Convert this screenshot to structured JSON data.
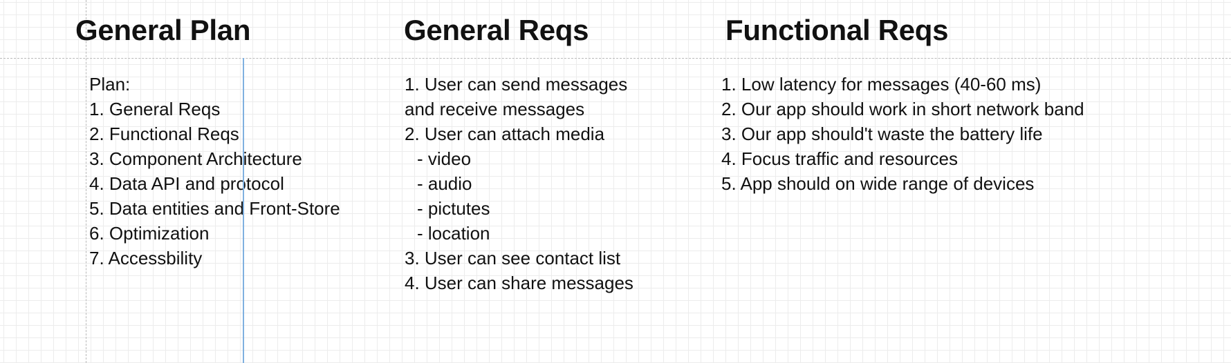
{
  "columns": [
    {
      "heading": "General Plan",
      "lines": [
        "Plan:",
        "1. General Reqs",
        "2. Functional Reqs",
        "3. Component Architecture",
        "4. Data API and protocol",
        "5. Data entities and Front-Store",
        "6. Optimization",
        "7. Accessbility"
      ]
    },
    {
      "heading": "General Reqs",
      "lines": [
        "1. User can send messages",
        "and receive messages",
        "2. User can attach media",
        "- video",
        "- audio",
        "- pictutes",
        "- location",
        "3. User can see contact list",
        "4. User can share messages"
      ]
    },
    {
      "heading": "Functional Reqs",
      "lines": [
        "1. Low latency for messages (40-60 ms)",
        "2. Our app should work in short network band",
        "3. Our app should't waste the battery life",
        "4. Focus traffic and resources",
        "5. App should on wide range of devices"
      ]
    }
  ]
}
